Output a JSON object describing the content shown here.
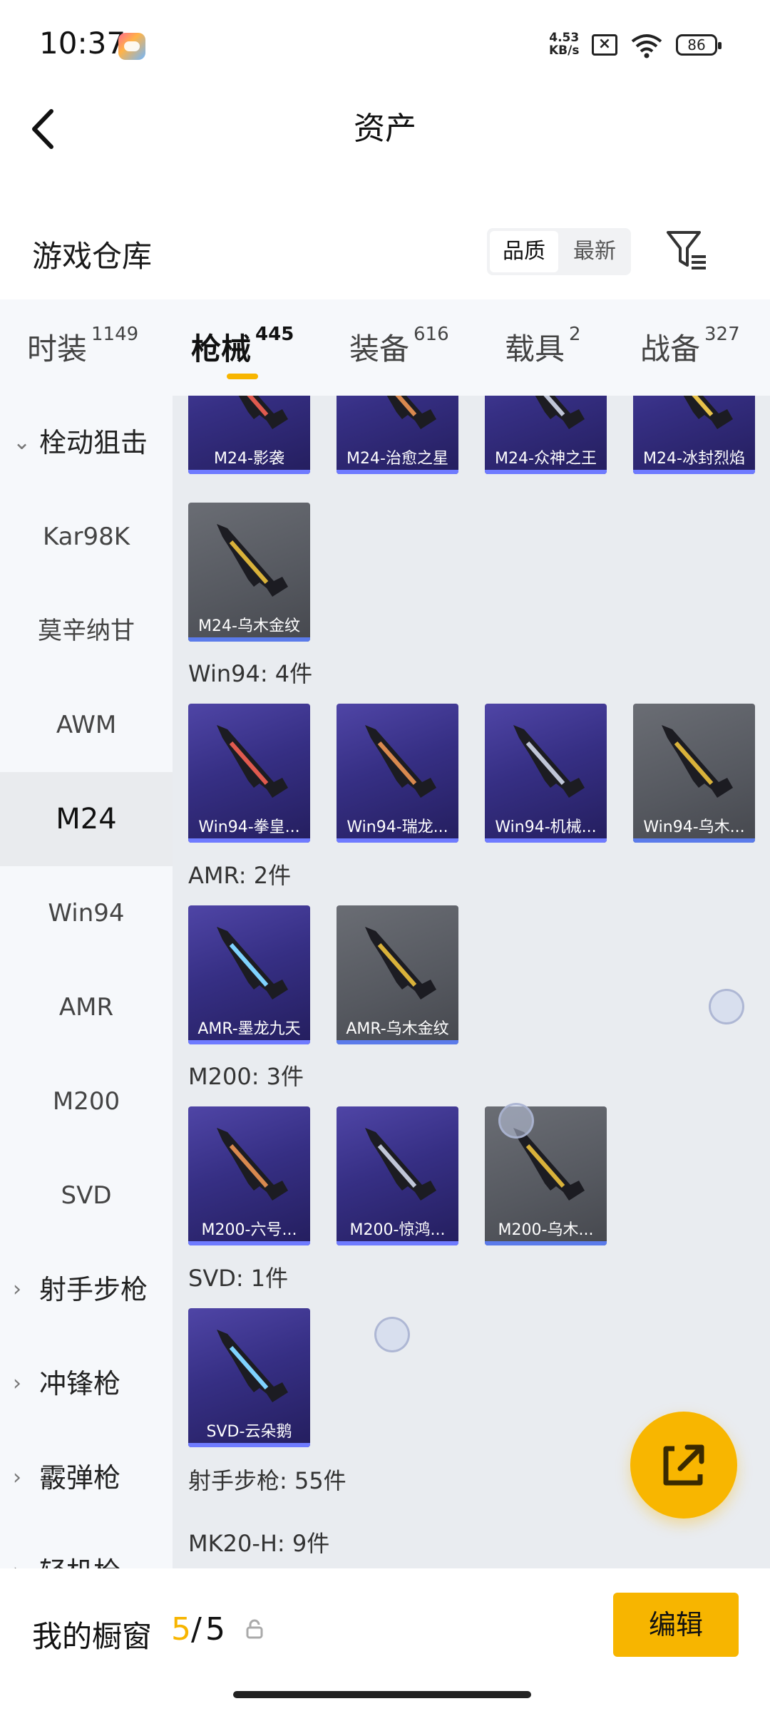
{
  "status_bar": {
    "time": "10:37",
    "net_speed_value": "4.53",
    "net_speed_unit": "KB/s",
    "battery": "86",
    "icons": [
      "game-app-icon",
      "sim-off-icon",
      "wifi-icon",
      "battery-icon"
    ]
  },
  "header": {
    "title": "资产",
    "back_icon": "chevron-left-icon"
  },
  "warehouse": {
    "title": "游戏仓库",
    "sort_options": [
      "品质",
      "最新"
    ],
    "selected_sort": "品质",
    "filter_icon": "filter-icon"
  },
  "tabs": [
    {
      "label": "时装",
      "count": "1149"
    },
    {
      "label": "枪械",
      "count": "445"
    },
    {
      "label": "装备",
      "count": "616"
    },
    {
      "label": "载具",
      "count": "2"
    },
    {
      "label": "战备",
      "count": "327"
    }
  ],
  "active_tab": "枪械",
  "sidebar": [
    {
      "label": "栓动狙击",
      "type": "group",
      "expanded": true
    },
    {
      "label": "Kar98K",
      "type": "item"
    },
    {
      "label": "莫辛纳甘",
      "type": "item"
    },
    {
      "label": "AWM",
      "type": "item"
    },
    {
      "label": "M24",
      "type": "item",
      "active": true
    },
    {
      "label": "Win94",
      "type": "item"
    },
    {
      "label": "AMR",
      "type": "item"
    },
    {
      "label": "M200",
      "type": "item"
    },
    {
      "label": "SVD",
      "type": "item"
    },
    {
      "label": "射手步枪",
      "type": "group",
      "expanded": false
    },
    {
      "label": "冲锋枪",
      "type": "group",
      "expanded": false
    },
    {
      "label": "霰弹枪",
      "type": "group",
      "expanded": false
    },
    {
      "label": "轻机枪",
      "type": "group",
      "expanded": false
    }
  ],
  "sections": {
    "m24_items": [
      "M24-影袭",
      "M24-治愈之星",
      "M24-众神之王",
      "M24-冰封烈焰",
      "M24-乌木金纹"
    ],
    "win94_header": "Win94: 4件",
    "win94_items": [
      "Win94-拳皇...",
      "Win94-瑞龙...",
      "Win94-机械...",
      "Win94-乌木..."
    ],
    "amr_header": "AMR: 2件",
    "amr_items": [
      "AMR-墨龙九天",
      "AMR-乌木金纹"
    ],
    "m200_header": "M200: 3件",
    "m200_items": [
      "M200-六号...",
      "M200-惊鸿...",
      "M200-乌木..."
    ],
    "svd_header": "SVD: 1件",
    "svd_items": [
      "SVD-云朵鹅"
    ],
    "dmr_header": "射手步枪: 55件",
    "mk20_header": "MK20-H: 9件"
  },
  "colors": {
    "accent": "#F7B500",
    "card_purple": "#3A3388",
    "card_gray": "#5A5D64",
    "card_bar": "#6F7BFF"
  },
  "bottom_bar": {
    "label": "我的橱窗",
    "count": "5",
    "separator": "/",
    "total": "5",
    "lock_icon": "lock-icon",
    "edit_label": "编辑"
  },
  "fab": {
    "icon": "share-external-icon"
  }
}
